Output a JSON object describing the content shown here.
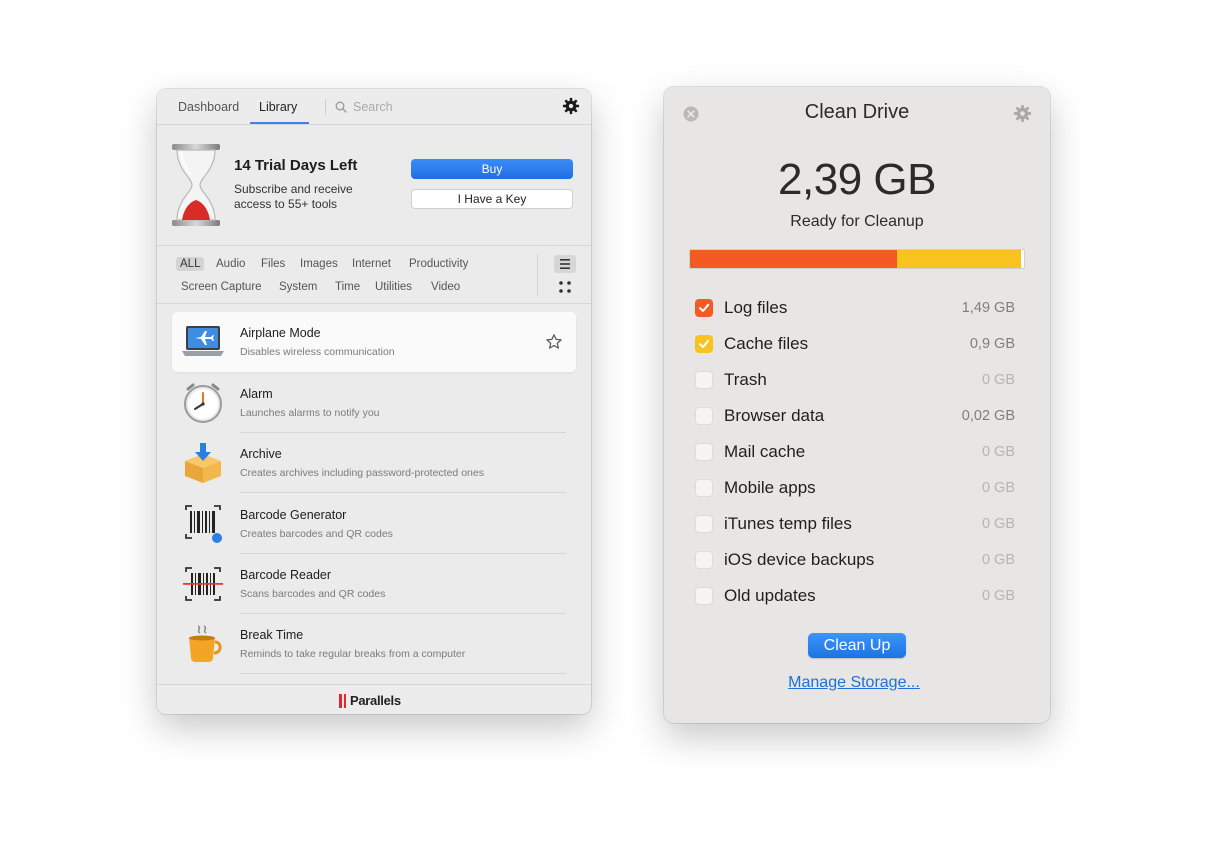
{
  "toolbox": {
    "tabs": [
      {
        "label": "Dashboard"
      },
      {
        "label": "Library"
      }
    ],
    "search": {
      "placeholder": "Search",
      "value": ""
    },
    "trial": {
      "title": "14 Trial Days Left",
      "subtitle": "Subscribe and receive access to 55+ tools",
      "buy_label": "Buy",
      "key_label": "I Have a Key"
    },
    "filters": {
      "row1": [
        "ALL",
        "Audio",
        "Files",
        "Images",
        "Internet",
        "Productivity"
      ],
      "row2": [
        "Screen Capture",
        "System",
        "Time",
        "Utilities",
        "Video"
      ],
      "active": "ALL"
    },
    "tools": [
      {
        "name": "Airplane Mode",
        "desc": "Disables wireless communication",
        "icon": "airplane-mode-icon"
      },
      {
        "name": "Alarm",
        "desc": "Launches alarms to notify you",
        "icon": "alarm-clock-icon"
      },
      {
        "name": "Archive",
        "desc": "Creates archives including password-protected ones",
        "icon": "archive-box-icon"
      },
      {
        "name": "Barcode Generator",
        "desc": "Creates barcodes and QR codes",
        "icon": "barcode-generator-icon"
      },
      {
        "name": "Barcode Reader",
        "desc": "Scans barcodes and QR codes",
        "icon": "barcode-reader-icon"
      },
      {
        "name": "Break Time",
        "desc": "Reminds to take regular breaks from a computer",
        "icon": "coffee-cup-icon"
      }
    ],
    "footer_brand": "Parallels"
  },
  "clean_drive": {
    "title": "Clean Drive",
    "total_size": "2,39 GB",
    "status": "Ready for Cleanup",
    "usage": {
      "log_fraction": 0.62,
      "cache_fraction": 0.37
    },
    "categories": [
      {
        "label": "Log files",
        "size": "1,49 GB",
        "checked": true,
        "color": "#f45a24"
      },
      {
        "label": "Cache files",
        "size": "0,9 GB",
        "checked": true,
        "color": "#f8c31f"
      },
      {
        "label": "Trash",
        "size": "0 GB",
        "checked": false
      },
      {
        "label": "Browser data",
        "size": "0,02 GB",
        "checked": false
      },
      {
        "label": "Mail cache",
        "size": "0 GB",
        "checked": false
      },
      {
        "label": "Mobile apps",
        "size": "0 GB",
        "checked": false
      },
      {
        "label": "iTunes temp files",
        "size": "0 GB",
        "checked": false
      },
      {
        "label": "iOS device backups",
        "size": "0 GB",
        "checked": false
      },
      {
        "label": "Old updates",
        "size": "0 GB",
        "checked": false
      }
    ],
    "clean_button": "Clean Up",
    "manage_link": "Manage Storage..."
  },
  "colors": {
    "accent": "#1f6fe3",
    "log": "#f45a24",
    "cache": "#f8c31f",
    "brand_red": "#e3262b"
  }
}
